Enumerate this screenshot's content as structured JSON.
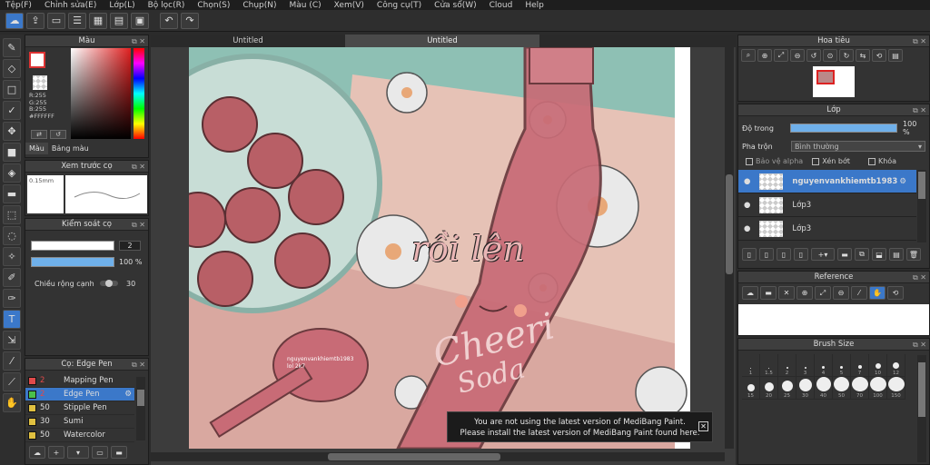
{
  "menu": [
    "Tệp(F)",
    "Chỉnh sửa(E)",
    "Lớp(L)",
    "Bộ lọc(R)",
    "Chọn(S)",
    "Chụp(N)",
    "Màu (C)",
    "Xem(V)",
    "Công cụ(T)",
    "Cửa sổ(W)",
    "Cloud",
    "Help"
  ],
  "color_panel": {
    "title": "Màu",
    "rgb": {
      "r": "R:255",
      "g": "G:255",
      "b": "B:255"
    },
    "hex": "#FFFFFF",
    "tab_color": "Màu",
    "tab_palette": "Bảng màu"
  },
  "brush_preview": {
    "title": "Xem trước cọ",
    "size": "0.15mm"
  },
  "brush_control": {
    "title": "Kiểm soát cọ",
    "size_value": "2",
    "opacity_value": "100 %",
    "edge_label": "Chiều rộng cạnh",
    "edge_value": "30"
  },
  "brush_list": {
    "title": "Cọ: Edge Pen",
    "items": [
      {
        "size": "2",
        "name": "Mapping Pen",
        "color": "#e04a4a"
      },
      {
        "size": "2",
        "name": "Edge Pen",
        "color": "#4ac04a"
      },
      {
        "size": "50",
        "name": "Stipple Pen",
        "color": "#e0c040"
      },
      {
        "size": "30",
        "name": "Sumi",
        "color": "#e0c040"
      },
      {
        "size": "50",
        "name": "Watercolor",
        "color": "#e0c040"
      }
    ]
  },
  "canvas": {
    "tabs": [
      "Untitled",
      "Untitled"
    ],
    "art_text": {
      "overlay": "rồi lên",
      "brand": "Cheeri",
      "sub": "Soda",
      "signature": "nguyenvankhiemtb1983",
      "signature2": "lol 2k7"
    },
    "notice_line1": "You are not using the latest version of MediBang Paint.",
    "notice_line2": "Please install the latest version of MediBang Paint found here."
  },
  "navigator": {
    "title": "Hoa tiêu"
  },
  "layers": {
    "title": "Lớp",
    "opacity_label": "Độ trong",
    "opacity_value": "100 %",
    "blend_label": "Pha trộn",
    "blend_value": "Bình thường",
    "opt_alpha": "Bảo vệ alpha",
    "opt_clip": "Xén bớt",
    "opt_lock": "Khóa",
    "items": [
      "nguyenvankhiemtb1983",
      "Lớp3",
      "Lớp3"
    ]
  },
  "reference": {
    "title": "Reference"
  },
  "brush_size": {
    "title": "Brush Size",
    "labels": [
      "1",
      "1.5",
      "2",
      "3",
      "4",
      "5",
      "7",
      "10",
      "12",
      "15",
      "20",
      "25",
      "30",
      "40",
      "50",
      "70",
      "100",
      "150"
    ]
  }
}
